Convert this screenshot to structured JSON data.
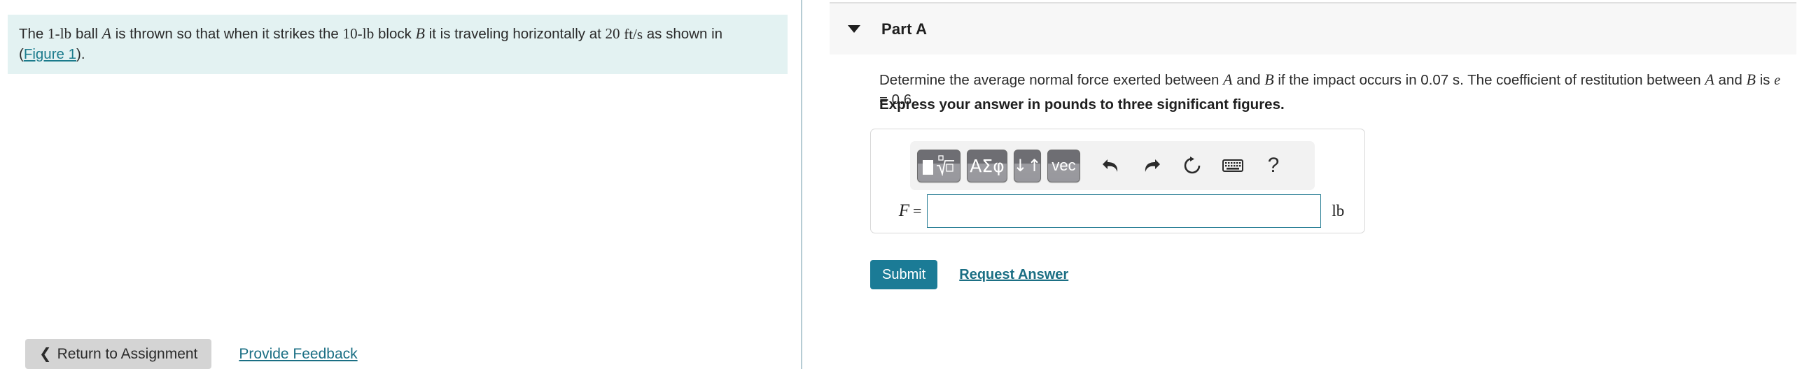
{
  "left_panel": {
    "problem": {
      "part1": "The ",
      "mass_a": "1-lb",
      "text2": " ball ",
      "var_a": "A",
      "text3": " is thrown so that when it strikes the ",
      "mass_b": "10-lb",
      "text4": " block ",
      "var_b": "B",
      "text5": " it is traveling horizontally at ",
      "speed_value": "20",
      "speed_unit_num": "ft",
      "speed_unit_den": "s",
      "text6": " as shown in ",
      "figure_link": "Figure 1",
      "paren_open": "(",
      "paren_close": ")."
    }
  },
  "right_panel": {
    "header": {
      "title": "Part A",
      "collapse_icon": "triangle-down-icon"
    },
    "question": {
      "part1": "Determine the average normal force exerted between ",
      "var_a": "A",
      "part2": " and ",
      "var_b": "B",
      "part3": " if the impact occurs in 0.07 s. The coefficient of restitution between ",
      "var_a2": "A",
      "part4": " and ",
      "var_b2": "B",
      "part5": " is ",
      "var_e": "e",
      "part6": " = 0.6."
    },
    "instruction": "Express your answer in pounds to three significant figures.",
    "answer_box": {
      "toolbar": {
        "template_button": {
          "name": "template-square-root-button",
          "icon": "square-nth-root-icon"
        },
        "greek_button": {
          "name": "greek-letters-button",
          "label": "ΑΣφ"
        },
        "arrows_button": {
          "name": "sub-superscript-button",
          "label": "↓↑"
        },
        "vec_button": {
          "name": "vector-button",
          "label": "vec"
        },
        "undo_icon": "undo-icon",
        "redo_icon": "redo-icon",
        "reset_icon": "reset-icon",
        "keyboard_icon": "keyboard-icon",
        "help_icon": "?"
      },
      "variable_label": "F",
      "equals": "=",
      "input_value": "",
      "input_placeholder": "",
      "unit": "lb"
    },
    "submit_label": "Submit",
    "request_answer_label": "Request Answer"
  },
  "footer": {
    "return_chevron": "❮",
    "return_label": "Return to Assignment",
    "provide_feedback_label": "Provide Feedback"
  },
  "colors": {
    "problem_box_bg": "#e3f2f2",
    "link_teal": "#1b7b8c",
    "submit_teal": "#1b7b96",
    "input_border_teal": "#2a7f96",
    "divider": "#b6ccd4",
    "header_bg": "#f7f7f7",
    "return_button_bg": "#d4d4d4"
  }
}
